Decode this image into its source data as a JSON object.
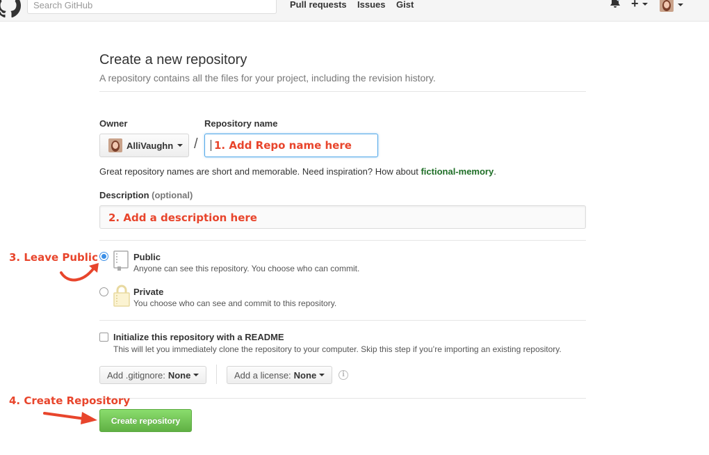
{
  "header": {
    "search_placeholder": "Search GitHub",
    "nav": [
      "Pull requests",
      "Issues",
      "Gist"
    ],
    "plus_glyph": "+"
  },
  "page": {
    "title": "Create a new repository",
    "subtitle": "A repository contains all the files for your project, including the revision history."
  },
  "owner": {
    "label": "Owner",
    "value": "AlliVaughn"
  },
  "repo": {
    "label": "Repository name",
    "separator": "/",
    "hint_prefix": "Great repository names are short and memorable. Need inspiration? How about ",
    "suggestion": "fictional-memory",
    "hint_suffix": "."
  },
  "description": {
    "label": "Description",
    "optional": "(optional)"
  },
  "visibility": {
    "public_title": "Public",
    "public_desc": "Anyone can see this repository. You choose who can commit.",
    "private_title": "Private",
    "private_desc": "You choose who can see and commit to this repository.",
    "selected": "public"
  },
  "readme": {
    "title": "Initialize this repository with a README",
    "desc": "This will let you immediately clone the repository to your computer. Skip this step if you’re importing an existing repository."
  },
  "gitignore": {
    "label": "Add .gitignore:",
    "value": "None"
  },
  "license": {
    "label": "Add a license:",
    "value": "None"
  },
  "info_glyph": "i",
  "create_button": "Create repository",
  "annotations": {
    "step1": "1. Add Repo name here",
    "step2": "2. Add a description here",
    "step3": "3. Leave Public",
    "step4": "4. Create Repository"
  },
  "colors": {
    "annotation": "#e8452c",
    "create_button": "#60b044",
    "focus": "#51a7e8",
    "suggestion": "#1e6e26"
  },
  "icons": [
    "github-logo-icon",
    "bell-icon",
    "plus-icon",
    "repo-book-icon",
    "lock-icon",
    "info-icon",
    "arrow-icon"
  ]
}
